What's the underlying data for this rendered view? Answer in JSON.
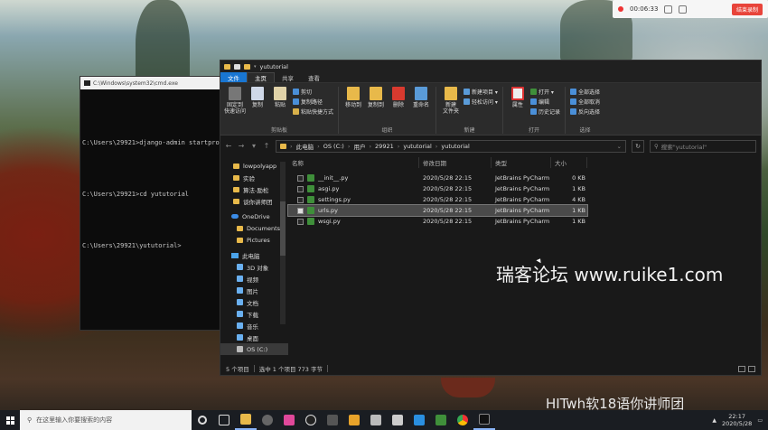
{
  "recorder": {
    "time": "00:06:33",
    "stop_label": "结束录制"
  },
  "cmd": {
    "title": "C:\\Windows\\system32\\cmd.exe",
    "lines": [
      "C:\\Users\\29921>django-admin startpro",
      "C:\\Users\\29921>cd yututorial",
      "C:\\Users\\29921\\yututorial>"
    ]
  },
  "explorer": {
    "title": "yututorial",
    "tabs": {
      "file": "文件",
      "home": "主页",
      "share": "共享",
      "view": "查看"
    },
    "ribbon": {
      "pin": "固定到\n快速访问",
      "copy": "复制",
      "paste": "粘贴",
      "cut": "剪切",
      "copy_path": "复制路径",
      "paste_shortcut": "粘贴快捷方式",
      "clipboard_group": "剪贴板",
      "move_to": "移动到",
      "copy_to": "复制到",
      "delete": "删除",
      "rename": "重命名",
      "organize_group": "组织",
      "new_folder": "新建\n文件夹",
      "new_item": "新建项目 ▾",
      "easy_access": "轻松访问 ▾",
      "new_group": "新建",
      "properties": "属性",
      "open": "打开 ▾",
      "edit": "编辑",
      "history": "历史记录",
      "open_group": "打开",
      "select_all": "全部选择",
      "select_none": "全部取消",
      "invert": "反向选择",
      "select_group": "选择"
    },
    "address": {
      "crumbs": [
        "此电脑",
        "OS (C:)",
        "用户",
        "29921",
        "yututorial",
        "yututorial"
      ]
    },
    "search_placeholder": "搜索\"yututorial\"",
    "nav": [
      "lowpolyapp",
      "实验",
      "算法-励松",
      "谈你讲师团",
      "OneDrive",
      "Documents",
      "Pictures",
      "此电脑",
      "3D 对象",
      "视频",
      "图片",
      "文档",
      "下载",
      "音乐",
      "桌面",
      "OS (C:)"
    ],
    "columns": {
      "name": "名称",
      "date": "修改日期",
      "type": "类型",
      "size": "大小"
    },
    "files": [
      {
        "name": "__init__.py",
        "date": "2020/5/28 22:15",
        "type": "JetBrains PyCharm",
        "size": "0 KB"
      },
      {
        "name": "asgi.py",
        "date": "2020/5/28 22:15",
        "type": "JetBrains PyCharm",
        "size": "1 KB"
      },
      {
        "name": "settings.py",
        "date": "2020/5/28 22:15",
        "type": "JetBrains PyCharm",
        "size": "4 KB"
      },
      {
        "name": "urls.py",
        "date": "2020/5/28 22:15",
        "type": "JetBrains PyCharm",
        "size": "1 KB"
      },
      {
        "name": "wsgi.py",
        "date": "2020/5/28 22:15",
        "type": "JetBrains PyCharm",
        "size": "1 KB"
      }
    ],
    "status": {
      "count": "5 个项目",
      "selected": "选中 1 个项目 773 字节"
    },
    "watermark": "瑞客论坛 www.ruike1.com"
  },
  "signature": "HITwh软18语你讲师团",
  "taskbar": {
    "search_placeholder": "在这里输入你要搜索的内容",
    "time": "22:17",
    "date": "2020/5/28"
  },
  "colors": {
    "file_tab": "#1976d2",
    "record_stop": "#e8443a",
    "python_icon": "#3f8f3a"
  }
}
